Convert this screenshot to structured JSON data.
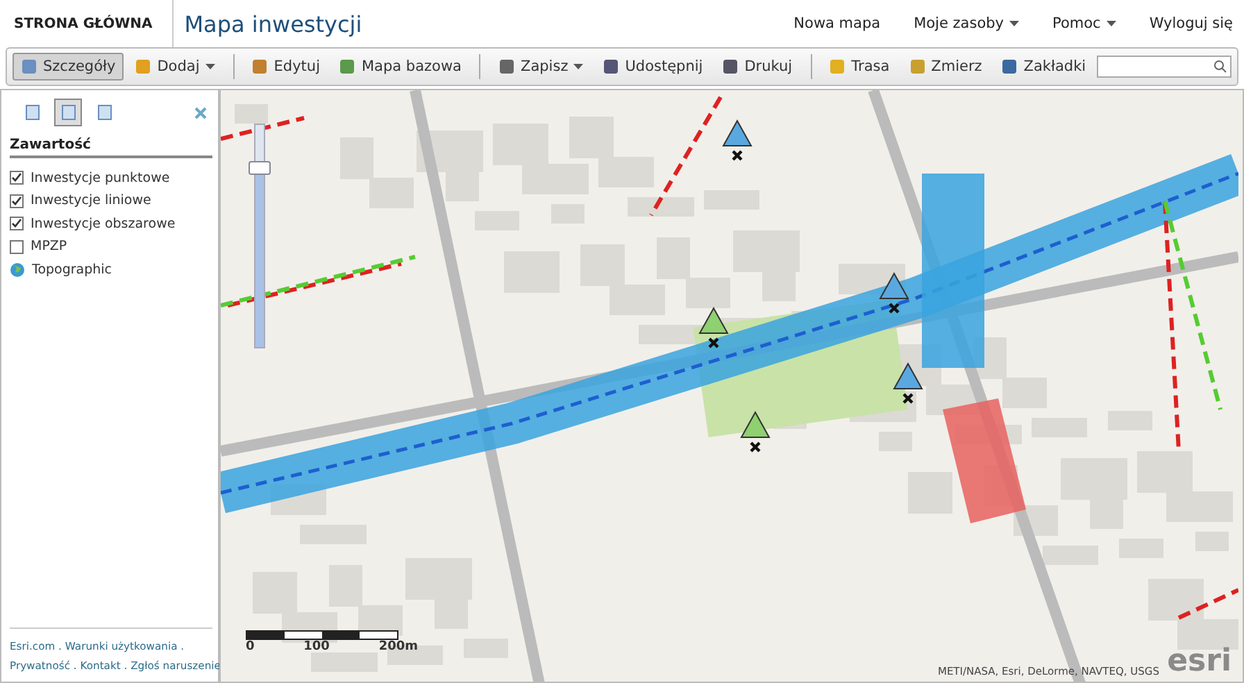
{
  "header": {
    "home": "STRONA GŁÓWNA",
    "title": "Mapa inwestycji",
    "nav": [
      {
        "label": "Nowa mapa",
        "dropdown": false
      },
      {
        "label": "Moje zasoby",
        "dropdown": true
      },
      {
        "label": "Pomoc",
        "dropdown": true
      },
      {
        "label": "Wyloguj się",
        "dropdown": false
      }
    ]
  },
  "toolbar": {
    "groups": [
      [
        {
          "label": "Szczegóły",
          "selected": true,
          "dropdown": false
        },
        {
          "label": "Dodaj",
          "selected": false,
          "dropdown": true
        }
      ],
      [
        {
          "label": "Edytuj",
          "selected": false,
          "dropdown": false
        },
        {
          "label": "Mapa bazowa",
          "selected": false,
          "dropdown": false
        }
      ],
      [
        {
          "label": "Zapisz",
          "selected": false,
          "dropdown": true
        },
        {
          "label": "Udostępnij",
          "selected": false,
          "dropdown": false
        },
        {
          "label": "Drukuj",
          "selected": false,
          "dropdown": false
        }
      ],
      [
        {
          "label": "Trasa",
          "selected": false,
          "dropdown": false
        },
        {
          "label": "Zmierz",
          "selected": false,
          "dropdown": false
        },
        {
          "label": "Zakładki",
          "selected": false,
          "dropdown": false
        }
      ]
    ]
  },
  "sidebar": {
    "tabs": [
      {
        "selected": false
      },
      {
        "selected": true
      },
      {
        "selected": false
      }
    ],
    "heading": "Zawartość",
    "layers": [
      {
        "kind": "checkbox",
        "label": "Inwestycje punktowe",
        "checked": true
      },
      {
        "kind": "checkbox",
        "label": "Inwestycje liniowe",
        "checked": true
      },
      {
        "kind": "checkbox",
        "label": "Inwestycje obszarowe",
        "checked": true
      },
      {
        "kind": "checkbox",
        "label": "MPZP",
        "checked": false
      },
      {
        "kind": "basemap",
        "label": "Topographic"
      }
    ],
    "footer": [
      [
        "Esri.com",
        "Warunki użytkowania"
      ],
      [
        "Prywatność",
        "Kontakt",
        "Zgłoś naruszenie"
      ]
    ],
    "separator": "."
  },
  "map": {
    "zoom": {
      "level": 0.8
    },
    "scale": [
      "0",
      "100",
      "200m"
    ],
    "attribution": "METI/NASA, Esri, DeLorme, NAVTEQ, USGS",
    "logo": "esri"
  }
}
